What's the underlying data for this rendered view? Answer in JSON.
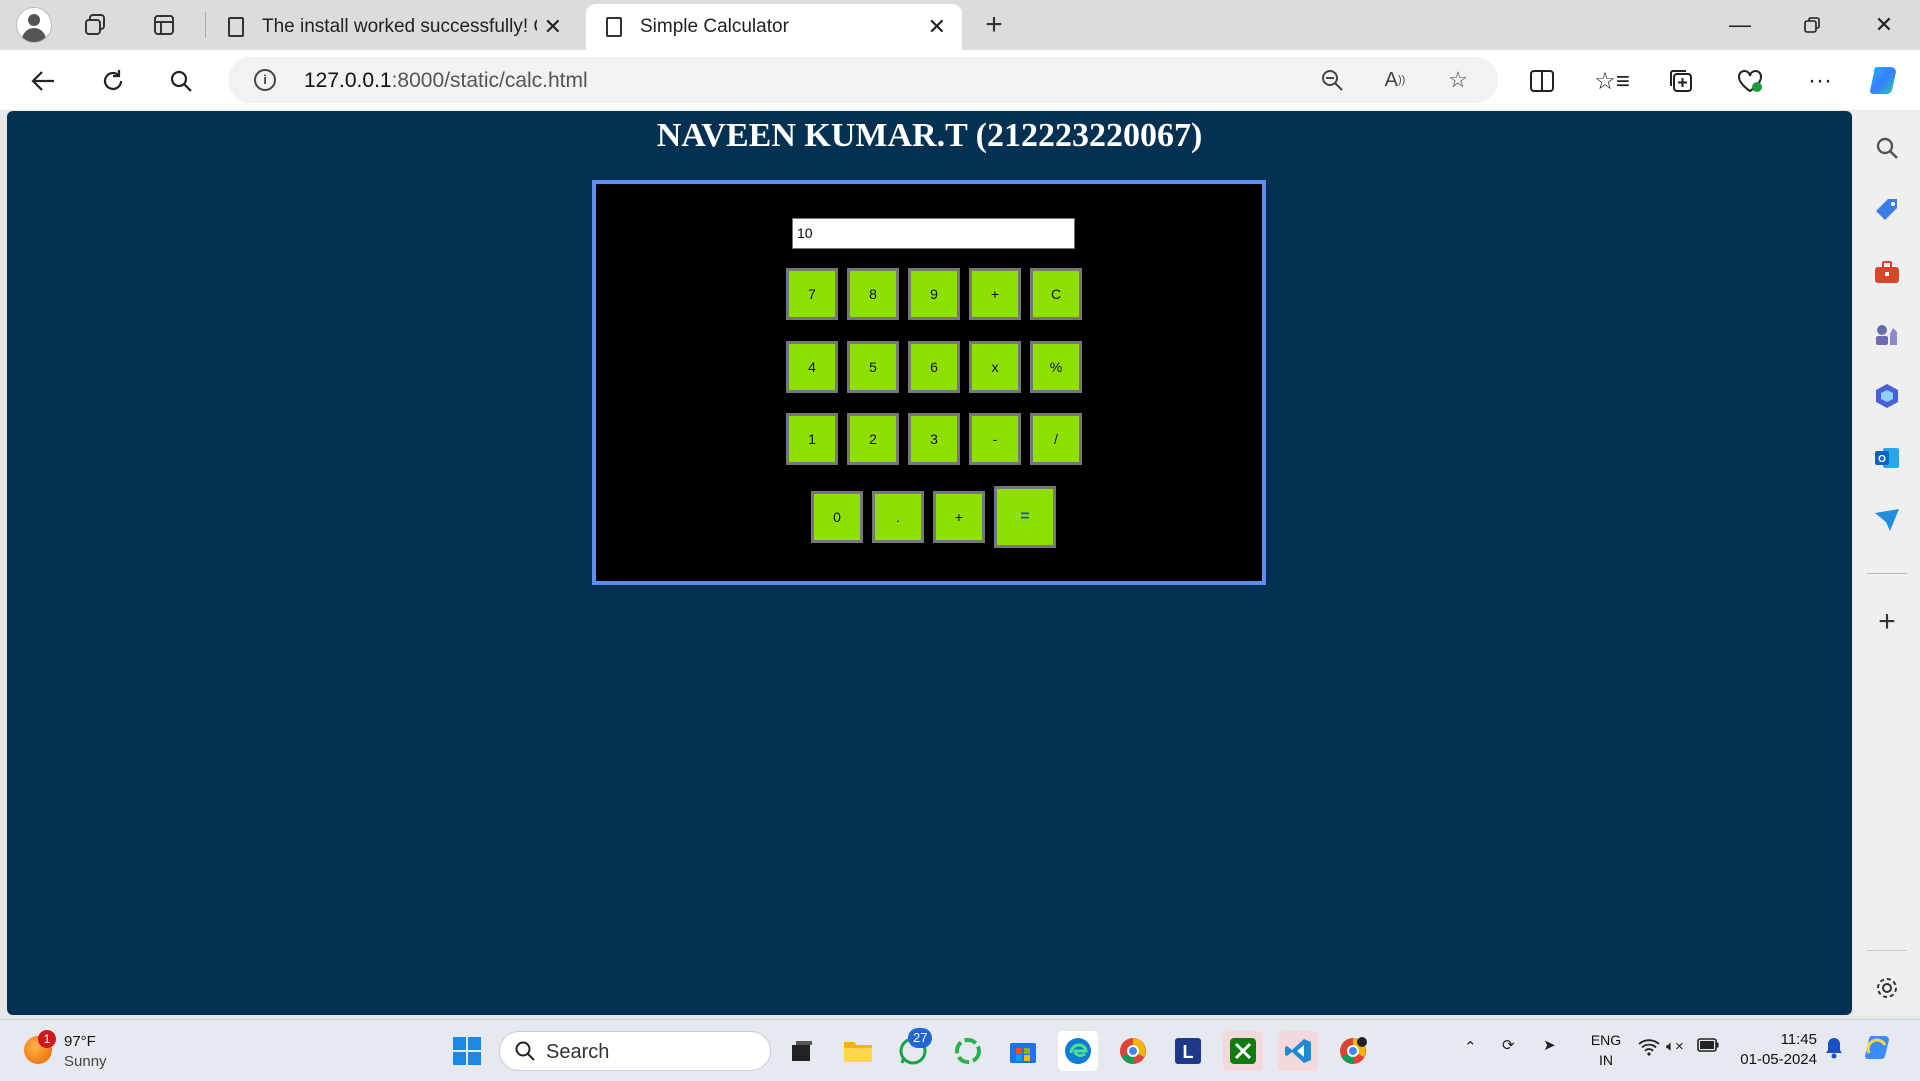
{
  "browser": {
    "tabs": [
      {
        "title": "The install worked successfully! C",
        "active": false
      },
      {
        "title": "Simple Calculator",
        "active": true
      }
    ],
    "url_host": "127.0.0.1",
    "url_path": ":8000/static/calc.html",
    "sidebar_icons": [
      "search-icon",
      "tag-icon",
      "toolbox-icon",
      "games-icon",
      "copilot-app-icon",
      "outlook-icon",
      "send-icon",
      "add-icon",
      "settings-icon"
    ]
  },
  "page": {
    "heading": "NAVEEN KUMAR.T (212223220067)",
    "display_value": "10",
    "keys": {
      "k7": "7",
      "k8": "8",
      "k9": "9",
      "kplus1": "+",
      "kclear": "C",
      "k4": "4",
      "k5": "5",
      "k6": "6",
      "kmul": "x",
      "kmod": "%",
      "k1": "1",
      "k2": "2",
      "k3": "3",
      "kminus": "-",
      "kdiv": "/",
      "k0": "0",
      "kdot": ".",
      "kplus2": "+",
      "keq": "="
    },
    "colors": {
      "background": "#043152",
      "panel": "#000000",
      "panel_border": "#5b8ff0",
      "key": "#8ee000"
    }
  },
  "taskbar": {
    "weather_badge": "1",
    "temperature": "97°F",
    "condition": "Sunny",
    "search_label": "Search",
    "whatsapp_badge": "27",
    "lang_line1": "ENG",
    "lang_line2": "IN",
    "time": "11:45",
    "date": "01-05-2024"
  }
}
